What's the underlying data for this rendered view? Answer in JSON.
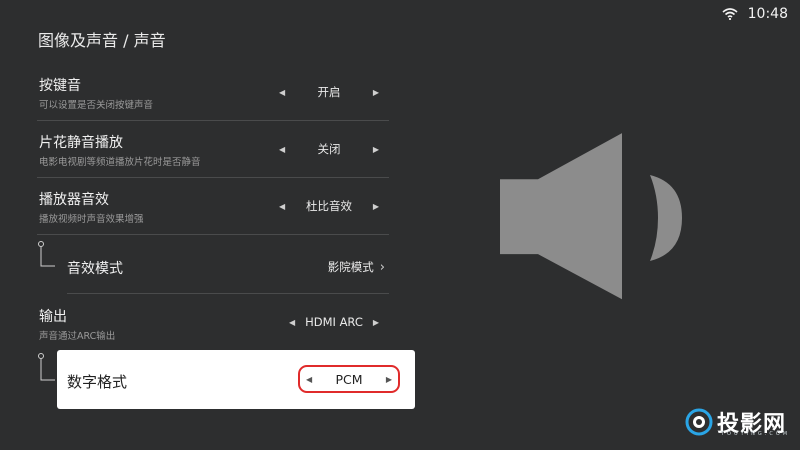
{
  "status": {
    "time": "10:48",
    "wifi_icon": "wifi-icon"
  },
  "page": {
    "title": "图像及声音 / 声音"
  },
  "settings": [
    {
      "title": "按键音",
      "desc": "可以设置是否关闭按键声音",
      "value": "开启"
    },
    {
      "title": "片花静音播放",
      "desc": "电影电视剧等频道播放片花时是否静音",
      "value": "关闭"
    },
    {
      "title": "播放器音效",
      "desc": "播放视频时声音效果增强",
      "value": "杜比音效"
    }
  ],
  "sound_mode": {
    "title": "音效模式",
    "value": "影院模式"
  },
  "output": {
    "title": "输出",
    "desc": "声音通过ARC输出",
    "value": "HDMI ARC"
  },
  "digital_format": {
    "title": "数字格式",
    "value": "PCM"
  },
  "illustration": {
    "icon": "speaker-icon"
  },
  "watermark": {
    "brand": "投影网",
    "sub": "TOUYING.COM"
  },
  "colors": {
    "background": "#2d2e2f",
    "popup": "#ffffff",
    "highlight": "#e02b2b",
    "speaker": "#8c8c8c"
  }
}
